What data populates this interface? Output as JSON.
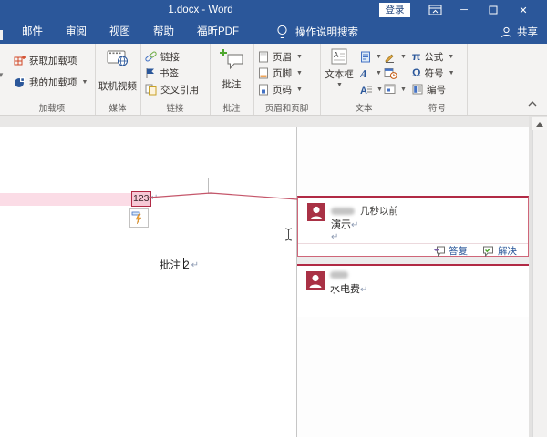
{
  "window": {
    "title": "1.docx - Word",
    "sign_in_label": "登录"
  },
  "tab_bar": {
    "mailings": "邮件",
    "review": "审阅",
    "view": "视图",
    "help": "帮助",
    "foxit_pdf": "福昕PDF",
    "tell_me": "操作说明搜索",
    "share": "共享"
  },
  "ribbon": {
    "addins_group": {
      "label": "加载项",
      "get_addins": "获取加载项",
      "my_addins": "我的加载项"
    },
    "media_group": {
      "label": "媒体",
      "online_video": "联机视频"
    },
    "links_group": {
      "label": "链接",
      "link": "链接",
      "bookmark": "书签",
      "cross_reference": "交叉引用"
    },
    "comment_group": {
      "label": "批注",
      "comment": "批注"
    },
    "header_footer_group": {
      "label": "页眉和页脚",
      "header": "页眉",
      "footer": "页脚",
      "page_number": "页码"
    },
    "text_group": {
      "label": "文本",
      "text_box": "文本框"
    },
    "symbols_group": {
      "label": "符号",
      "pi": "π",
      "equation": "公式",
      "omega": "Ω",
      "symbol": "符号",
      "number": "编号"
    }
  },
  "document": {
    "highlighted_text": "123",
    "pilcrow": "↵",
    "paragraph_text": "批注 2"
  },
  "comments": {
    "first": {
      "time": "几秒以前",
      "text": "演示",
      "pilcrow": "↵",
      "reply": "答复",
      "resolve": "解决"
    },
    "second": {
      "text": "水电费",
      "pilcrow": "↵"
    }
  },
  "colors": {
    "accent_blue": "#2b579a",
    "comment_red": "#b12a45",
    "highlight_pink": "#fbdce6"
  }
}
